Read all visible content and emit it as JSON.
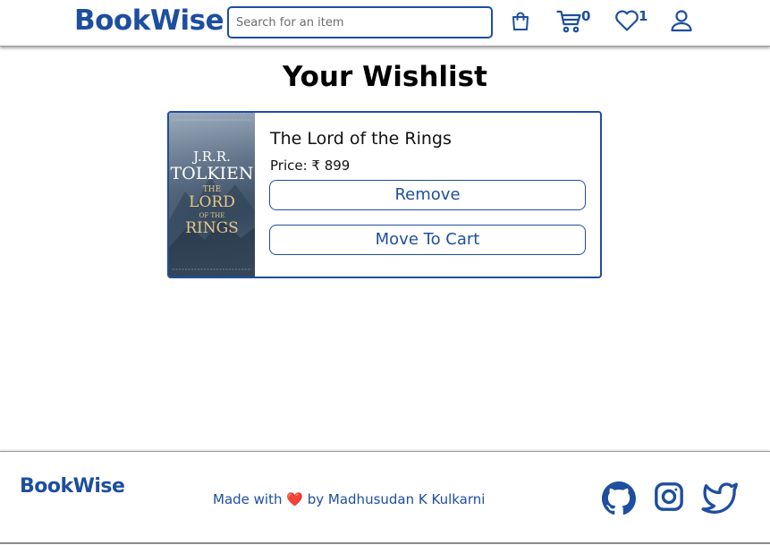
{
  "header": {
    "brand": "BookWise",
    "search_placeholder": "Search for an item",
    "icons": [
      "shopping-bag-icon",
      "cart-icon",
      "heart-icon",
      "user-icon"
    ],
    "cart_count": "0",
    "wishlist_count": "1"
  },
  "main": {
    "title": "Your Wishlist",
    "items": [
      {
        "title": "The Lord of the Rings",
        "price": "Price: ₹ 899",
        "remove_label": "Remove",
        "move_label": "Move To Cart",
        "cover": {
          "author": "J.R.R.",
          "author_surname": "TOLKIEN",
          "line1": "THE",
          "line2": "LORD",
          "line3": "OF THE",
          "line4": "RINGS"
        }
      }
    ]
  },
  "footer": {
    "brand": "BookWise",
    "credit_prefix": "Made with",
    "heart": "❤️",
    "credit_suffix": "by Madhusudan K Kulkarni",
    "social_icons": [
      "github-icon",
      "instagram-icon",
      "twitter-icon"
    ]
  },
  "colors": {
    "accent": "#1d4e9f",
    "heart": "#e0252d"
  }
}
